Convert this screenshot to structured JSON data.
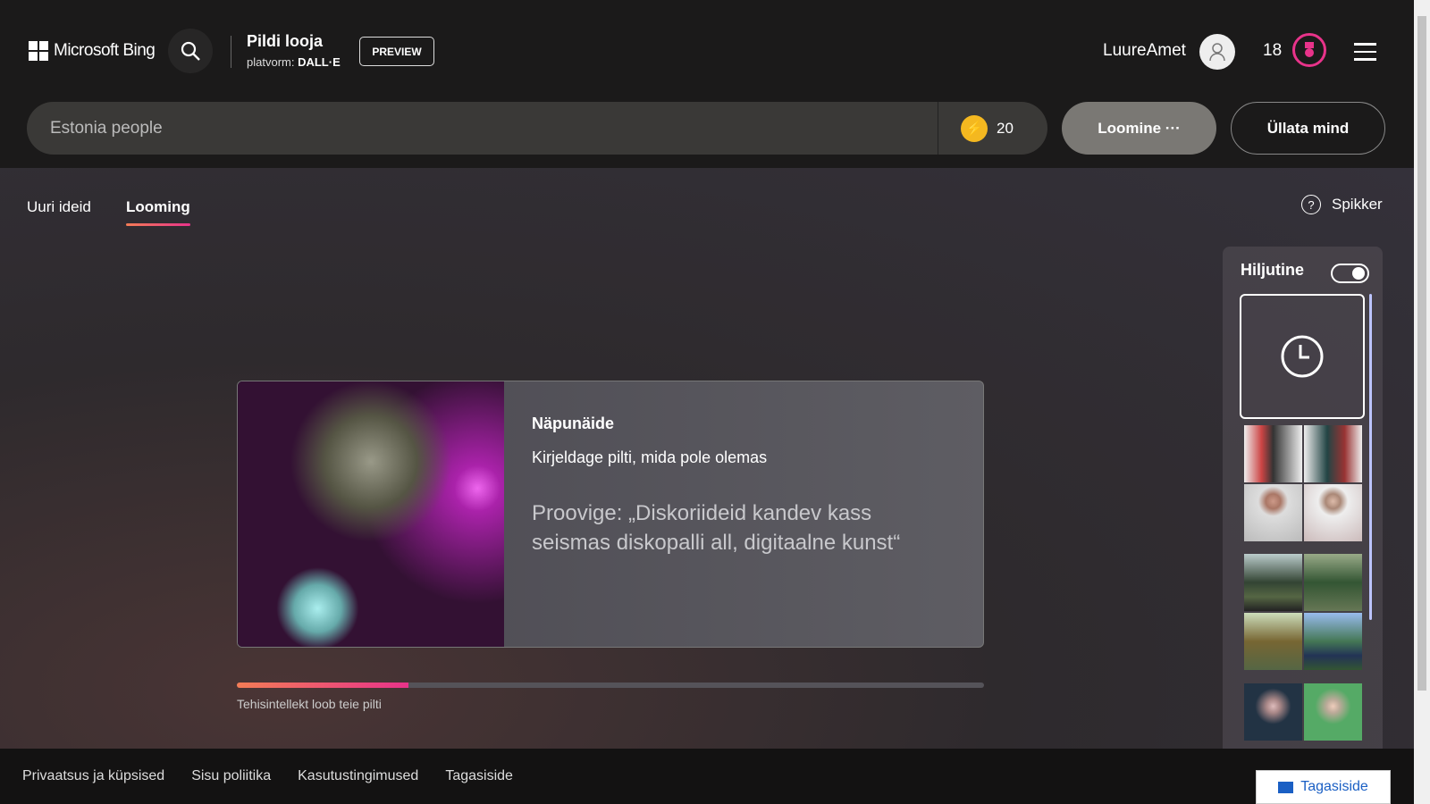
{
  "header": {
    "brand": "Microsoft Bing",
    "title": "Pildi looja",
    "platform_label": "platvorm:",
    "platform": "DALL·E",
    "preview": "PREVIEW",
    "username": "LuureAmet",
    "rewards": "18"
  },
  "search": {
    "value": "Estonia people",
    "boosts": "20",
    "create": "Loomine",
    "create_suffix": "···",
    "surprise": "Üllata mind"
  },
  "tabs": [
    {
      "label": "Uuri ideid"
    },
    {
      "label": "Looming"
    }
  ],
  "help": "Spikker",
  "tip": {
    "title": "Näpunäide",
    "desc": "Kirjeldage pilti, mida pole olemas",
    "example": "Proovige: „Diskoriideid kandev kass seismas diskopalli all, digitaalne kunst“"
  },
  "progress": {
    "percent": 23,
    "label": "Tehisintellekt loob teie pilti"
  },
  "recent": {
    "title": "Hiljutine",
    "toggle_on": true
  },
  "footer": {
    "links": [
      "Privaatsus ja küpsised",
      "Sisu poliitika",
      "Kasutustingimused",
      "Tagasiside"
    ],
    "feedback": "Tagasiside"
  },
  "colors": {
    "accent": "#e8338a",
    "accent2": "#f37c56"
  }
}
